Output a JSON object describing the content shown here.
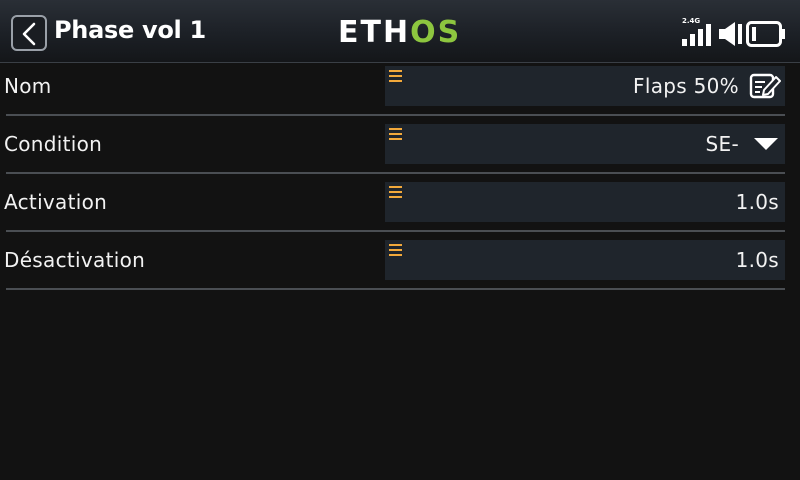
{
  "header": {
    "title": "Phase vol 1",
    "logo_part1": "ETH",
    "logo_part2": "OS",
    "rf_band": "2.4G"
  },
  "rows": [
    {
      "label": "Nom",
      "value": "Flaps 50%",
      "value_icon": "edit-icon"
    },
    {
      "label": "Condition",
      "value": "SE-",
      "value_icon": "dropdown-arrow-icon"
    },
    {
      "label": "Activation",
      "value": "1.0s"
    },
    {
      "label": "Désactivation",
      "value": "1.0s"
    }
  ],
  "colors": {
    "accent_green": "#8dc63f",
    "handle_orange": "#f2a93b",
    "field_bg": "#1f252c",
    "background": "#121212"
  }
}
